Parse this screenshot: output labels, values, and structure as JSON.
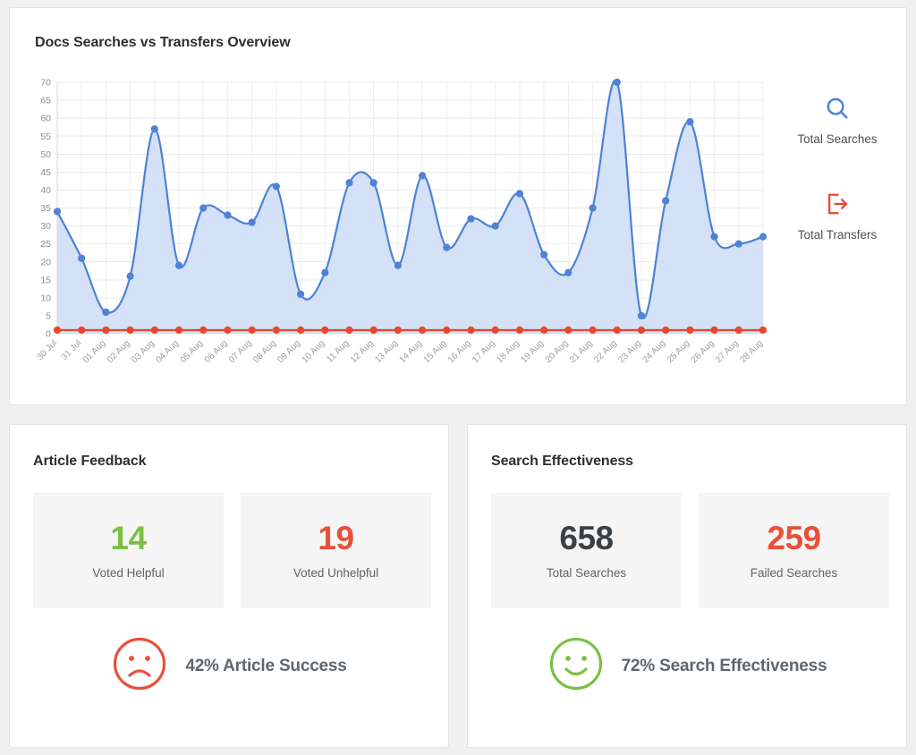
{
  "theme": {
    "page_bg": "#f0f0f1",
    "card_bg": "#ffffff",
    "card_border": "#e4e4e6",
    "searches_color": "#4d82d6",
    "searches_fill": "#ccdcf5",
    "transfers_color": "#ea462b",
    "green": "#7ac143",
    "red": "#e8503a",
    "dark": "#3b4045",
    "muted": "#5d6468"
  },
  "chart_card": {
    "title": "Docs Searches vs Transfers Overview",
    "legend": [
      {
        "label": "Total Searches",
        "icon": "search-icon",
        "color": "#4d82d6"
      },
      {
        "label": "Total Transfers",
        "icon": "transfer-out-icon",
        "color": "#ea462b"
      }
    ]
  },
  "chart_data": {
    "type": "line",
    "title": "Docs Searches vs Transfers Overview",
    "xlabel": "",
    "ylabel": "",
    "ylim": [
      0,
      70
    ],
    "yticks": [
      0,
      5,
      10,
      15,
      20,
      25,
      30,
      35,
      40,
      45,
      50,
      55,
      60,
      65,
      70
    ],
    "grid": true,
    "legend_position": "right",
    "area_fill": true,
    "curve": "smooth",
    "categories": [
      "30 Jul",
      "31 Jul",
      "01 Aug",
      "02 Aug",
      "03 Aug",
      "04 Aug",
      "05 Aug",
      "06 Aug",
      "07 Aug",
      "08 Aug",
      "09 Aug",
      "10 Aug",
      "11 Aug",
      "12 Aug",
      "13 Aug",
      "14 Aug",
      "15 Aug",
      "16 Aug",
      "17 Aug",
      "18 Aug",
      "19 Aug",
      "20 Aug",
      "21 Aug",
      "22 Aug",
      "23 Aug",
      "24 Aug",
      "25 Aug",
      "26 Aug",
      "27 Aug",
      "28 Aug"
    ],
    "series": [
      {
        "name": "Total Searches",
        "color": "#4d82d6",
        "values": [
          34,
          21,
          6,
          16,
          57,
          19,
          35,
          33,
          31,
          41,
          11,
          17,
          42,
          42,
          19,
          44,
          24,
          32,
          30,
          39,
          22,
          17,
          35,
          70,
          5,
          37,
          59,
          27,
          25,
          27
        ]
      },
      {
        "name": "Total Transfers",
        "color": "#ea462b",
        "values": [
          1,
          1,
          1,
          1,
          1,
          1,
          1,
          1,
          1,
          1,
          1,
          1,
          1,
          1,
          1,
          1,
          1,
          1,
          1,
          1,
          1,
          1,
          1,
          1,
          1,
          1,
          1,
          1,
          1,
          1
        ]
      }
    ]
  },
  "article_feedback": {
    "title": "Article Feedback",
    "stats": [
      {
        "value": "14",
        "label": "Voted Helpful",
        "color": "#7ac143"
      },
      {
        "value": "19",
        "label": "Voted Unhelpful",
        "color": "#e8503a"
      }
    ],
    "summary": {
      "text": "42% Article Success",
      "icon": "sad-face-icon",
      "icon_color": "#e8503a"
    }
  },
  "search_effectiveness": {
    "title": "Search Effectiveness",
    "stats": [
      {
        "value": "658",
        "label": "Total Searches",
        "color": "#3b4045"
      },
      {
        "value": "259",
        "label": "Failed Searches",
        "color": "#e8503a"
      }
    ],
    "summary": {
      "text": "72% Search Effectiveness",
      "icon": "happy-face-icon",
      "icon_color": "#7ac143"
    }
  }
}
